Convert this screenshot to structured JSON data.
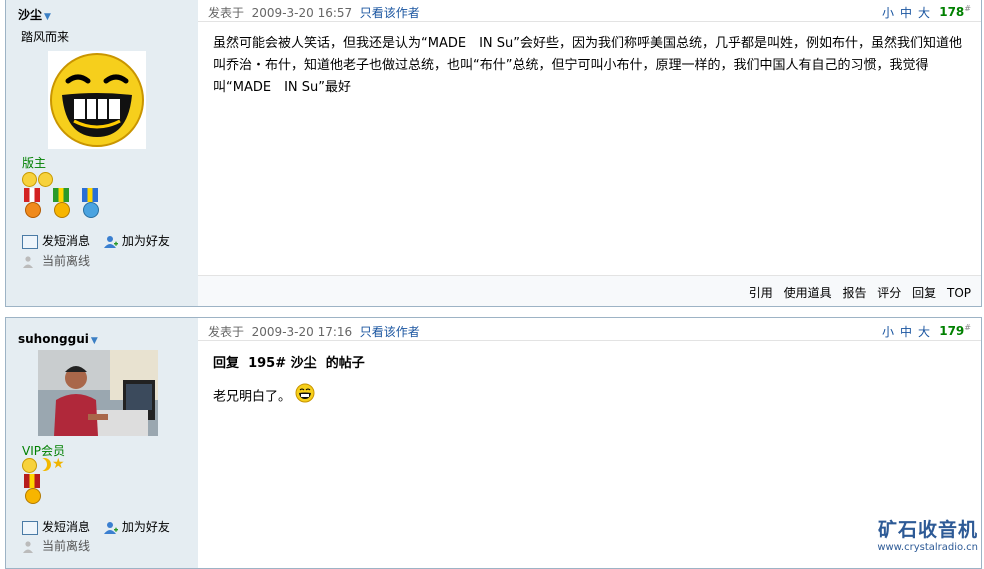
{
  "posts": [
    {
      "author": {
        "name": "沙尘",
        "title": "踏风而来",
        "group": "版主"
      },
      "actions": {
        "message": "发短消息",
        "friend": "加为好友",
        "status": "当前离线"
      },
      "meta": {
        "posted_label": "发表于",
        "datetime": "2009-3-20 16:57",
        "only_author": "只看该作者"
      },
      "font_sizes": [
        "小",
        "中",
        "大"
      ],
      "floor": "178",
      "floor_mark": "#",
      "content": "虽然可能会被人笑话，但我还是认为“MADE　IN Su”会好些，因为我们称呼美国总统，几乎都是叫姓，例如布什，虽然我们知道他叫乔治・布什，知道他老子也做过总统，也叫“布什”总统，但宁可叫小布什，原理一样的，我们中国人有自己的习惯，我觉得叫“MADE　IN Su”最好",
      "footer_links": [
        "引用",
        "使用道具",
        "报告",
        "评分",
        "回复",
        "TOP"
      ]
    },
    {
      "author": {
        "name": "suhonggui",
        "group": "VIP会员"
      },
      "actions": {
        "message": "发短消息",
        "friend": "加为好友",
        "status": "当前离线"
      },
      "meta": {
        "posted_label": "发表于",
        "datetime": "2009-3-20 17:16",
        "only_author": "只看该作者"
      },
      "font_sizes": [
        "小",
        "中",
        "大"
      ],
      "floor": "179",
      "floor_mark": "#",
      "reply_prefix": "回复",
      "reply_floor": "195#",
      "reply_user": "沙尘",
      "reply_suffix": "的帖子",
      "content": "老兄明白了。"
    }
  ],
  "watermark": {
    "title": "矿石收音机",
    "url": "www.crystalradio.cn"
  },
  "colors": {
    "sidebar_bg": "#e5edf2",
    "link": "#1a55a0",
    "floor": "#008000",
    "border": "#9db3c5"
  }
}
